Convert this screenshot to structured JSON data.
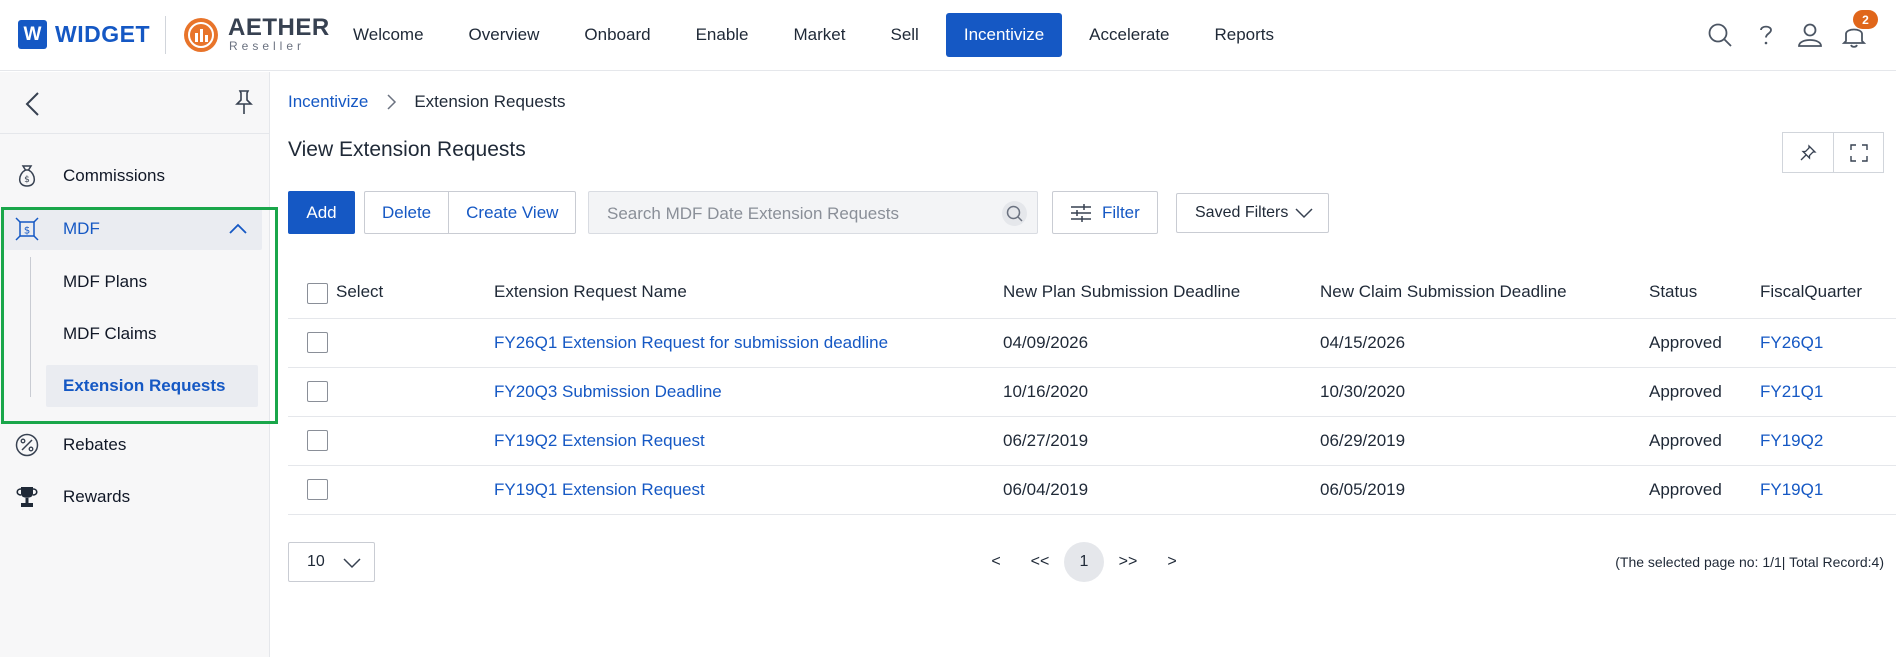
{
  "brand": {
    "widget_mark": "W",
    "widget_name": "WIDGET",
    "aether_name": "AETHER",
    "aether_sub": "Reseller"
  },
  "nav": {
    "items": [
      {
        "label": "Welcome"
      },
      {
        "label": "Overview"
      },
      {
        "label": "Onboard"
      },
      {
        "label": "Enable"
      },
      {
        "label": "Market"
      },
      {
        "label": "Sell"
      },
      {
        "label": "Incentivize",
        "active": true
      },
      {
        "label": "Accelerate"
      },
      {
        "label": "Reports"
      }
    ],
    "notification_count": "2",
    "accent": "#1558c4"
  },
  "sidebar": {
    "items": {
      "commissions": "Commissions",
      "mdf": "MDF",
      "mdf_plans": "MDF Plans",
      "mdf_claims": "MDF Claims",
      "extension_requests": "Extension Requests",
      "rebates": "Rebates",
      "rewards": "Rewards"
    },
    "highlight_color": "#19a64a"
  },
  "breadcrumb": {
    "parent": "Incentivize",
    "current": "Extension Requests"
  },
  "page": {
    "title": "View Extension Requests"
  },
  "toolbar": {
    "add": "Add",
    "delete": "Delete",
    "create_view": "Create View",
    "search_placeholder": "Search MDF Date Extension Requests",
    "filter": "Filter",
    "saved_filters": "Saved Filters"
  },
  "table": {
    "headers": {
      "select": "Select",
      "name": "Extension Request Name",
      "plan_deadline": "New Plan Submission Deadline",
      "claim_deadline": "New Claim Submission Deadline",
      "status": "Status",
      "quarter": "FiscalQuarter"
    },
    "rows": [
      {
        "name": "FY26Q1 Extension Request for submission deadline",
        "plan_deadline": "04/09/2026",
        "claim_deadline": "04/15/2026",
        "status": "Approved",
        "quarter": "FY26Q1"
      },
      {
        "name": "FY20Q3 Submission Deadline",
        "plan_deadline": "10/16/2020",
        "claim_deadline": "10/30/2020",
        "status": "Approved",
        "quarter": "FY21Q1"
      },
      {
        "name": "FY19Q2 Extension Request",
        "plan_deadline": "06/27/2019",
        "claim_deadline": "06/29/2019",
        "status": "Approved",
        "quarter": "FY19Q2"
      },
      {
        "name": "FY19Q1 Extension Request",
        "plan_deadline": "06/04/2019",
        "claim_deadline": "06/05/2019",
        "status": "Approved",
        "quarter": "FY19Q1"
      }
    ]
  },
  "pagination": {
    "page_size": "10",
    "prev": "<",
    "first": "<<",
    "current_page": "1",
    "last": ">>",
    "next": ">",
    "info": "(The selected page no: 1/1| Total Record:4)"
  }
}
